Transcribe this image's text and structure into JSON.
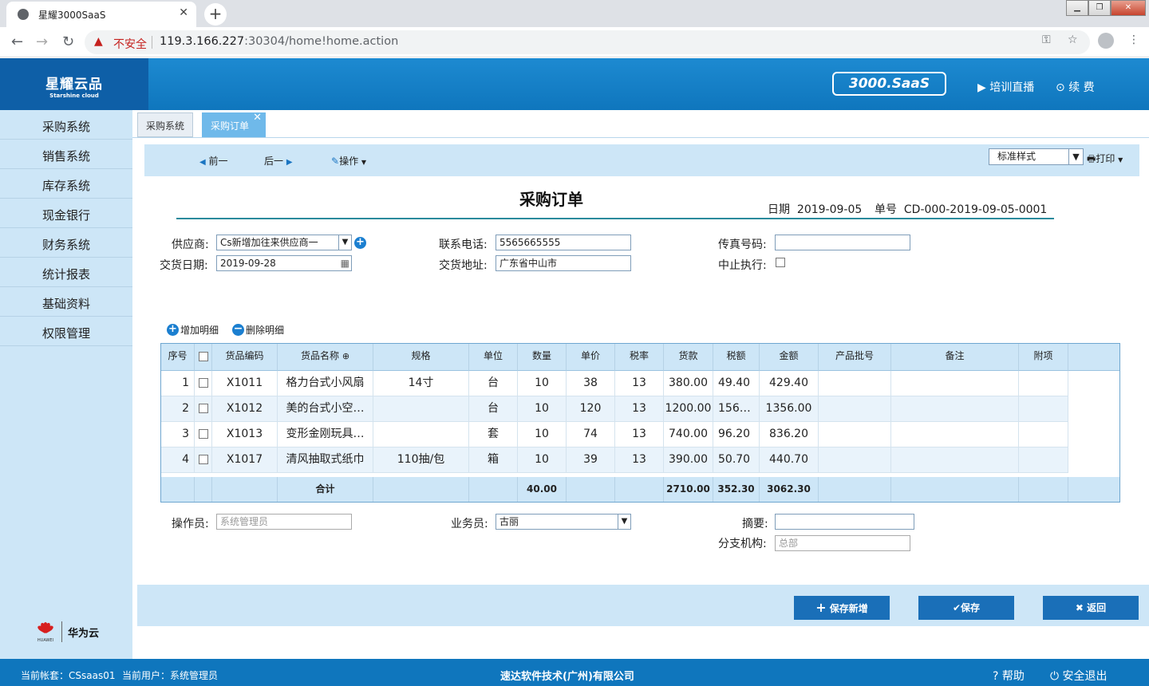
{
  "browser": {
    "tab_title": "星耀3000SaaS",
    "insecure_label": "不安全",
    "url_host": "119.3.166.227",
    "url_rest": ":30304/home!home.action"
  },
  "header": {
    "logo_cn": "星耀云品",
    "logo_en": "Starshine cloud",
    "saas_badge": "3000.SaaS",
    "training_label": "培训直播",
    "renew_label": "续 费"
  },
  "sidebar": {
    "items": [
      {
        "label": "采购系统"
      },
      {
        "label": "销售系统"
      },
      {
        "label": "库存系统"
      },
      {
        "label": "现金银行"
      },
      {
        "label": "财务系统"
      },
      {
        "label": "统计报表"
      },
      {
        "label": "基础资料"
      },
      {
        "label": "权限管理"
      }
    ],
    "partner_brand": "HUAWEI",
    "partner_label": "华为云"
  },
  "tabs": [
    {
      "label": "采购系统"
    },
    {
      "label": "采购订单",
      "close": "✕"
    }
  ],
  "toolbar": {
    "prev_label": "前一",
    "next_label": "后一",
    "action_label": "操作",
    "style_select": "标准样式",
    "print_label": "打印"
  },
  "form": {
    "title": "采购订单",
    "date_label": "日期",
    "date_value": "2019-09-05",
    "no_label": "单号",
    "no_value": "CD-000-2019-09-05-0001",
    "supplier_label": "供应商:",
    "supplier_value": "Cs新增加往来供应商一",
    "delivery_date_label": "交货日期:",
    "delivery_date_value": "2019-09-28",
    "phone_label": "联系电话:",
    "phone_value": "5565665555",
    "address_label": "交货地址:",
    "address_value": "广东省中山市",
    "fax_label": "传真号码:",
    "fax_value": "",
    "stop_label": "中止执行:",
    "add_detail_label": "增加明细",
    "delete_detail_label": "删除明细",
    "operator_label": "操作员:",
    "operator_value": "系统管理员",
    "salesman_label": "业务员:",
    "salesman_value": "古丽",
    "summary_label": "摘要:",
    "summary_value": "",
    "branch_label": "分支机构:",
    "branch_value": "总部"
  },
  "table": {
    "headers": [
      "序号",
      "",
      "货品编码",
      "货品名称",
      "规格",
      "单位",
      "数量",
      "单价",
      "税率",
      "货款",
      "税额",
      "金额",
      "产品批号",
      "备注",
      "附项"
    ],
    "rows": [
      [
        "1",
        "X1011",
        "格力台式小风扇",
        "14寸",
        "台",
        "10",
        "38",
        "13",
        "380.00",
        "49.40",
        "429.40"
      ],
      [
        "2",
        "X1012",
        "美的台式小空…",
        "",
        "台",
        "10",
        "120",
        "13",
        "1200.00",
        "156…",
        "1356.00"
      ],
      [
        "3",
        "X1013",
        "变形金刚玩具…",
        "",
        "套",
        "10",
        "74",
        "13",
        "740.00",
        "96.20",
        "836.20"
      ],
      [
        "4",
        "X1017",
        "清风抽取式纸巾",
        "110抽/包",
        "箱",
        "10",
        "39",
        "13",
        "390.00",
        "50.70",
        "440.70"
      ]
    ],
    "total_label": "合计",
    "total_qty": "40.00",
    "total_goods": "2710.00",
    "total_tax": "352.30",
    "total_amount": "3062.30"
  },
  "buttons": {
    "save_new": "保存新增",
    "save": "保存",
    "back": "返回"
  },
  "status": {
    "account": "当前帐套：CSsaas01",
    "user": "当前用户：系统管理员",
    "company": "速达软件技术(广州)有限公司",
    "help": "帮助",
    "logout": "安全退出"
  }
}
